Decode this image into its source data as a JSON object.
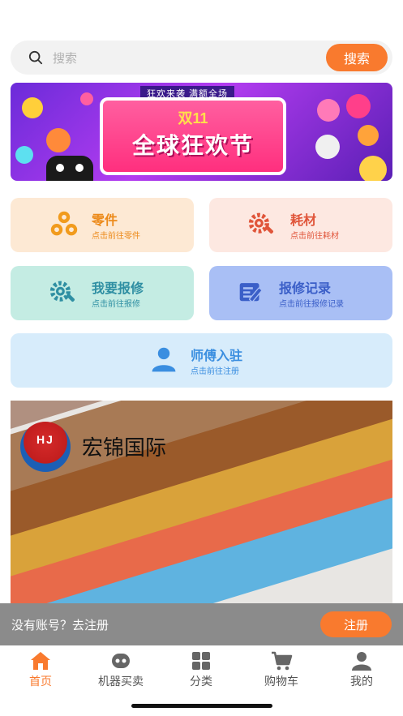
{
  "search": {
    "placeholder": "搜索",
    "button_label": "搜索"
  },
  "banner": {
    "top_text": "狂欢来袭 满额全场",
    "title_line1": "双11",
    "title_line2": "全球狂欢节"
  },
  "cards": [
    {
      "title": "零件",
      "subtitle": "点击前往零件",
      "icon": "parts-icon"
    },
    {
      "title": "耗材",
      "subtitle": "点击前往耗材",
      "icon": "consumables-gear-icon"
    },
    {
      "title": "我要报修",
      "subtitle": "点击前往报修",
      "icon": "repair-gear-icon"
    },
    {
      "title": "报修记录",
      "subtitle": "点击前往报修记录",
      "icon": "repair-record-icon"
    },
    {
      "title": "师傅入驻",
      "subtitle": "点击前往注册",
      "icon": "user-icon"
    }
  ],
  "promo": {
    "logo_text": "HJ",
    "brand": "宏锦国际"
  },
  "register_bar": {
    "text": "没有账号？去注册",
    "button_label": "注册"
  },
  "tabs": [
    {
      "label": "首页",
      "icon": "home-icon",
      "active": true
    },
    {
      "label": "机器买卖",
      "icon": "machine-icon",
      "active": false
    },
    {
      "label": "分类",
      "icon": "grid-icon",
      "active": false
    },
    {
      "label": "购物车",
      "icon": "cart-icon",
      "active": false
    },
    {
      "label": "我的",
      "icon": "profile-icon",
      "active": false
    }
  ],
  "colors": {
    "accent": "#f97a2e",
    "card_parts_bg": "#fde9d4",
    "card_consumables_bg": "#fde8e1",
    "card_repair_bg": "#c4ece3",
    "card_record_bg": "#a9bff5",
    "card_master_bg": "#d7ecfb"
  }
}
